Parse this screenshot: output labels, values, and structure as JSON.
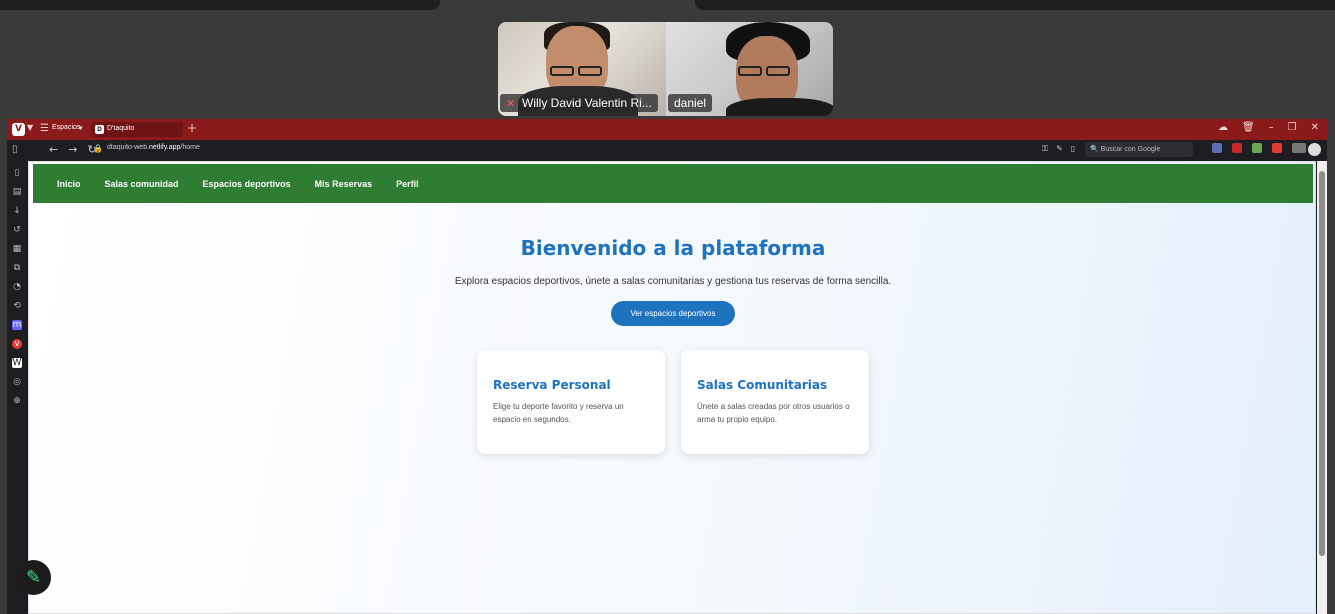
{
  "meeting": {
    "participants": [
      {
        "name": "Willy David Valentin Ri..."
      },
      {
        "name": "daniel"
      }
    ]
  },
  "browser": {
    "spaces_label": "Espacios",
    "tab_title": "D'taquito",
    "url_prefix": "dtaquito-web.",
    "url_domain": "netlify.app",
    "url_path": "/home",
    "search_placeholder": "Buscar con Google"
  },
  "site": {
    "nav": [
      "Inicio",
      "Salas comunidad",
      "Espacios deportivos",
      "Mis Reservas",
      "Perfil"
    ],
    "hero_title": "Bienvenido a la plataforma",
    "hero_subtitle": "Explora espacios deportivos, únete a salas comunitarias y gestiona tus reservas de forma sencilla.",
    "hero_button": "Ver espacios deportivos",
    "cards": [
      {
        "title": "Reserva Personal",
        "text": "Elige tu deporte favorito y reserva un espacio en segundos."
      },
      {
        "title": "Salas Comunitarias",
        "text": "Únete a salas creadas por otros usuarios o arma tu propio equipo."
      }
    ]
  },
  "colors": {
    "browser_titlebar": "#8b1a1a",
    "navbar": "#2e7d32",
    "accent": "#1e73be"
  }
}
